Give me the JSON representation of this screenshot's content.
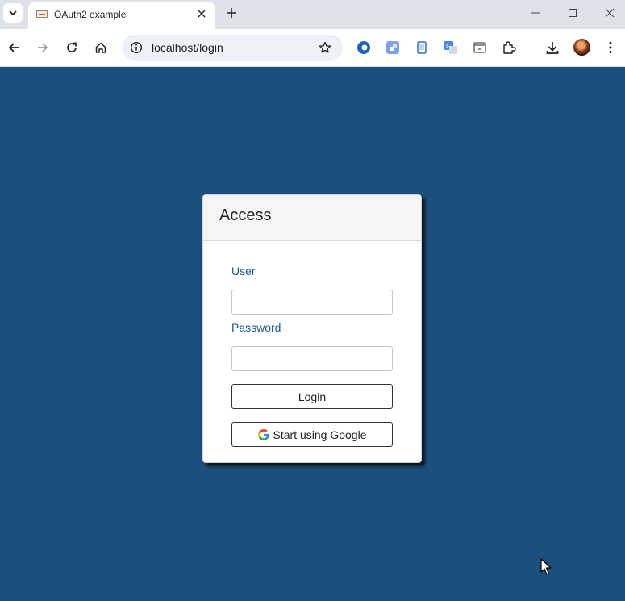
{
  "browser": {
    "tab": {
      "title": "OAuth2 example"
    },
    "omnibox": {
      "url": "localhost/login"
    }
  },
  "icons": {
    "tab_list": "chevron-down-icon",
    "close_tab": "close-icon",
    "new_tab": "plus-icon",
    "back": "arrow-left-icon",
    "forward": "arrow-right-icon",
    "reload": "reload-icon",
    "home": "home-icon",
    "site_info": "info-icon",
    "bookmark": "star-icon",
    "extensions": [
      "edge-extension-icon",
      "puzzle-box-icon",
      "phone-icon",
      "translate-icon",
      "calendar-window-icon",
      "extensions-puzzle-icon"
    ],
    "downloads": "download-icon",
    "menu": "kebab-menu-icon"
  },
  "login": {
    "title": "Access",
    "user_label": "User",
    "user_value": "",
    "password_label": "Password",
    "password_value": "",
    "login_button": "Login",
    "google_button": "Start using Google"
  },
  "colors": {
    "page_background": "#1c4f7b",
    "label": "#1d5a8c",
    "card_header": "#f5f5f4"
  }
}
